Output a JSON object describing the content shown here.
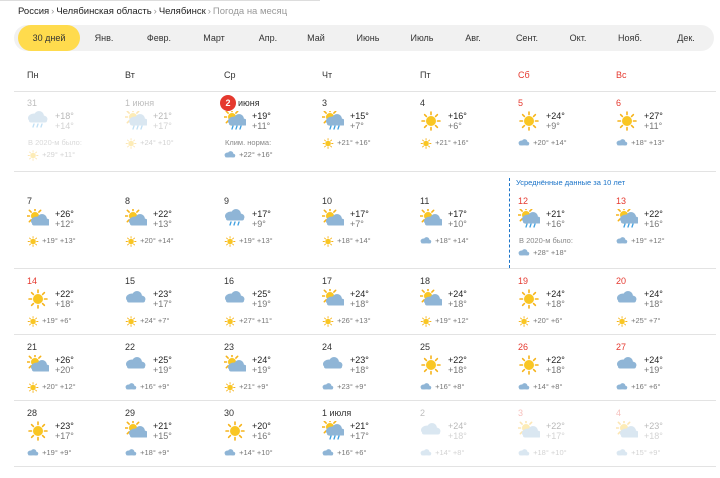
{
  "breadcrumb": {
    "items": [
      "Россия",
      "Челябинская область",
      "Челябинск"
    ],
    "current": "Погода на месяц",
    "sep": "›"
  },
  "tabs": [
    "30 дней",
    "Янв.",
    "Февр.",
    "Март",
    "Апр.",
    "Май",
    "Июнь",
    "Июль",
    "Авг.",
    "Сент.",
    "Окт.",
    "Нояб.",
    "Дек."
  ],
  "active_tab": 0,
  "daynames": [
    "Пн",
    "Вт",
    "Ср",
    "Чт",
    "Пт",
    "Сб",
    "Вс"
  ],
  "avg_label": "Усреднённые данные за 10 лет",
  "colors": {
    "accent": "#ffdb4d",
    "weekend": "#e5392f",
    "today": "#e5392f",
    "avg": "#1a73c8"
  },
  "weeks": [
    [
      {
        "date": "31",
        "icon": "rain-cloud-icon",
        "max": "+18°",
        "min": "+14°",
        "state": "past",
        "note": "В 2020-м было:",
        "hist": {
          "icon": "sun-icon",
          "text": "+29° +11°"
        }
      },
      {
        "date": "1 июня",
        "icon": "partly-cloudy-rain-icon",
        "max": "+21°",
        "min": "+17°",
        "state": "past",
        "hist": {
          "icon": "sun-icon",
          "text": "+24° +10°"
        }
      },
      {
        "date": "2",
        "month": "июня",
        "icon": "partly-cloudy-rain-icon",
        "max": "+19°",
        "min": "+11°",
        "state": "today",
        "note": "Клим. норма:",
        "hist": {
          "icon": "cloudy-icon",
          "text": "+22° +16°"
        }
      },
      {
        "date": "3",
        "icon": "partly-cloudy-rain-icon",
        "max": "+15°",
        "min": "+7°",
        "hist": {
          "icon": "sun-icon",
          "text": "+21° +16°"
        }
      },
      {
        "date": "4",
        "icon": "sun-icon",
        "max": "+16°",
        "min": "+6°",
        "hist": {
          "icon": "sun-icon",
          "text": "+21° +16°"
        }
      },
      {
        "date": "5",
        "icon": "sun-icon",
        "max": "+24°",
        "min": "+9°",
        "weekend": true,
        "hist": {
          "icon": "cloudy-icon",
          "text": "+20° +14°"
        }
      },
      {
        "date": "6",
        "icon": "sun-icon",
        "max": "+27°",
        "min": "+11°",
        "weekend": true,
        "hist": {
          "icon": "cloudy-icon",
          "text": "+18° +13°"
        }
      }
    ],
    [
      {
        "date": "7",
        "icon": "partly-cloudy-icon",
        "max": "+26°",
        "min": "+12°",
        "hist": {
          "icon": "sun-icon",
          "text": "+19° +13°"
        }
      },
      {
        "date": "8",
        "icon": "partly-cloudy-icon",
        "max": "+22°",
        "min": "+13°",
        "hist": {
          "icon": "sun-icon",
          "text": "+20° +14°"
        }
      },
      {
        "date": "9",
        "icon": "rain-cloud-icon",
        "max": "+17°",
        "min": "+9°",
        "hist": {
          "icon": "sun-icon",
          "text": "+19° +13°"
        }
      },
      {
        "date": "10",
        "icon": "partly-cloudy-icon",
        "max": "+17°",
        "min": "+7°",
        "hist": {
          "icon": "sun-icon",
          "text": "+18° +14°"
        }
      },
      {
        "date": "11",
        "icon": "partly-cloudy-icon",
        "max": "+17°",
        "min": "+10°",
        "hist": {
          "icon": "cloudy-icon",
          "text": "+18° +14°"
        }
      },
      {
        "date": "12",
        "icon": "partly-cloudy-rain-icon",
        "max": "+21°",
        "min": "+16°",
        "weekend": true,
        "note": "В 2020-м было:",
        "hist": {
          "icon": "cloudy-icon",
          "text": "+28° +18°"
        }
      },
      {
        "date": "13",
        "icon": "partly-cloudy-rain-icon",
        "max": "+22°",
        "min": "+16°",
        "weekend": true,
        "hist": {
          "icon": "cloudy-icon",
          "text": "+19° +12°"
        }
      }
    ],
    [
      {
        "date": "14",
        "icon": "sun-icon",
        "max": "+22°",
        "min": "+18°",
        "weekend": true,
        "hist": {
          "icon": "sun-icon",
          "text": "+19° +6°"
        }
      },
      {
        "date": "15",
        "icon": "cloudy-icon",
        "max": "+23°",
        "min": "+17°",
        "hist": {
          "icon": "sun-icon",
          "text": "+24° +7°"
        }
      },
      {
        "date": "16",
        "icon": "cloudy-icon",
        "max": "+25°",
        "min": "+19°",
        "hist": {
          "icon": "sun-icon",
          "text": "+27° +11°"
        }
      },
      {
        "date": "17",
        "icon": "partly-cloudy-icon",
        "max": "+24°",
        "min": "+18°",
        "hist": {
          "icon": "sun-icon",
          "text": "+26° +13°"
        }
      },
      {
        "date": "18",
        "icon": "partly-cloudy-icon",
        "max": "+24°",
        "min": "+18°",
        "hist": {
          "icon": "sun-icon",
          "text": "+19° +12°"
        }
      },
      {
        "date": "19",
        "icon": "sun-icon",
        "max": "+24°",
        "min": "+18°",
        "weekend": true,
        "hist": {
          "icon": "sun-icon",
          "text": "+20° +6°"
        }
      },
      {
        "date": "20",
        "icon": "cloudy-icon",
        "max": "+24°",
        "min": "+18°",
        "weekend": true,
        "hist": {
          "icon": "sun-icon",
          "text": "+25° +7°"
        }
      }
    ],
    [
      {
        "date": "21",
        "icon": "partly-cloudy-icon",
        "max": "+26°",
        "min": "+20°",
        "hist": {
          "icon": "sun-icon",
          "text": "+20° +12°"
        }
      },
      {
        "date": "22",
        "icon": "cloudy-icon",
        "max": "+25°",
        "min": "+19°",
        "hist": {
          "icon": "cloudy-icon",
          "text": "+16° +9°"
        }
      },
      {
        "date": "23",
        "icon": "partly-cloudy-icon",
        "max": "+24°",
        "min": "+19°",
        "hist": {
          "icon": "sun-icon",
          "text": "+21° +9°"
        }
      },
      {
        "date": "24",
        "icon": "cloudy-icon",
        "max": "+23°",
        "min": "+18°",
        "hist": {
          "icon": "cloudy-icon",
          "text": "+23° +9°"
        }
      },
      {
        "date": "25",
        "icon": "sun-icon",
        "max": "+22°",
        "min": "+18°",
        "hist": {
          "icon": "cloudy-icon",
          "text": "+16° +8°"
        }
      },
      {
        "date": "26",
        "icon": "sun-icon",
        "max": "+22°",
        "min": "+18°",
        "weekend": true,
        "hist": {
          "icon": "cloudy-icon",
          "text": "+14° +8°"
        }
      },
      {
        "date": "27",
        "icon": "cloudy-icon",
        "max": "+24°",
        "min": "+19°",
        "weekend": true,
        "hist": {
          "icon": "cloudy-icon",
          "text": "+16° +6°"
        }
      }
    ],
    [
      {
        "date": "28",
        "icon": "sun-icon",
        "max": "+23°",
        "min": "+17°",
        "hist": {
          "icon": "cloudy-icon",
          "text": "+19° +9°"
        }
      },
      {
        "date": "29",
        "icon": "partly-cloudy-icon",
        "max": "+21°",
        "min": "+15°",
        "hist": {
          "icon": "cloudy-icon",
          "text": "+18° +9°"
        }
      },
      {
        "date": "30",
        "icon": "sun-icon",
        "max": "+20°",
        "min": "+16°",
        "hist": {
          "icon": "cloudy-icon",
          "text": "+14° +10°"
        }
      },
      {
        "date": "1 июля",
        "icon": "partly-cloudy-rain-icon",
        "max": "+21°",
        "min": "+17°",
        "hist": {
          "icon": "cloudy-icon",
          "text": "+16° +6°"
        }
      },
      {
        "date": "2",
        "icon": "cloudy-icon",
        "max": "+24°",
        "min": "+18°",
        "state": "future",
        "hist": {
          "icon": "cloudy-icon",
          "text": "+14° +8°"
        }
      },
      {
        "date": "3",
        "icon": "partly-cloudy-icon",
        "max": "+22°",
        "min": "+17°",
        "state": "future",
        "weekend": true,
        "hist": {
          "icon": "cloudy-icon",
          "text": "+18° +10°"
        }
      },
      {
        "date": "4",
        "icon": "partly-cloudy-icon",
        "max": "+23°",
        "min": "+18°",
        "state": "future",
        "weekend": true,
        "hist": {
          "icon": "cloudy-icon",
          "text": "+15° +9°"
        }
      }
    ]
  ]
}
